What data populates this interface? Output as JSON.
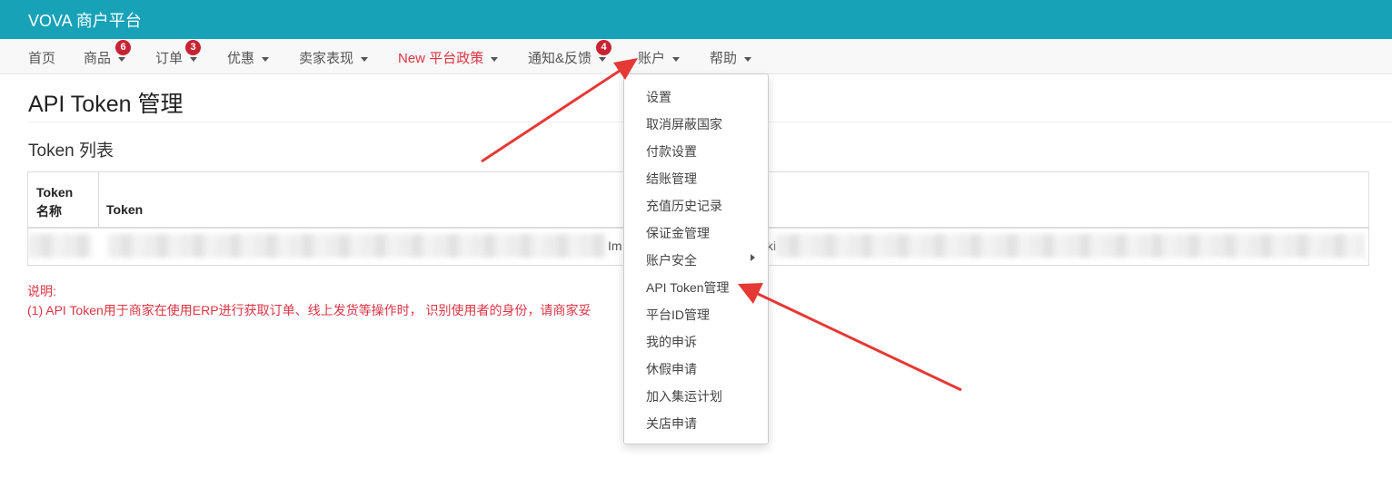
{
  "brand": "VOVA 商户平台",
  "nav": [
    {
      "label": "首页"
    },
    {
      "label": "商品",
      "badge": "6"
    },
    {
      "label": "订单",
      "badge": "3"
    },
    {
      "label": "优惠"
    },
    {
      "label": "卖家表现"
    },
    {
      "label_new": "New",
      "label": "平台政策"
    },
    {
      "label": "通知&反馈",
      "badge": "4"
    },
    {
      "label": "账户"
    },
    {
      "label": "帮助"
    }
  ],
  "page_title": "API Token 管理",
  "section_title": "Token 列表",
  "table": {
    "headers": [
      "Token 名称",
      "Token"
    ],
    "row_fragments": [
      "Im",
      "ki"
    ]
  },
  "notes": [
    "说明:",
    "(1) API Token用于商家在使用ERP进行获取订单、线上发货等操作时， 识别使用者的身份，请商家妥"
  ],
  "account_menu": [
    "设置",
    "取消屏蔽国家",
    "付款设置",
    "结账管理",
    "充值历史记录",
    "保证金管理",
    "账户安全",
    "API Token管理",
    "平台ID管理",
    "我的申诉",
    "休假申请",
    "加入集运计划",
    "关店申请"
  ],
  "colors": {
    "topbar": "#17a2b8",
    "badge": "#c82333",
    "note": "#dc3545",
    "arrow": "#e53935"
  }
}
